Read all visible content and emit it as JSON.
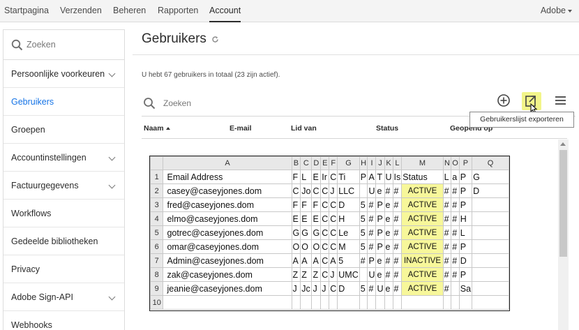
{
  "topnav": {
    "tabs": [
      {
        "label": "Startpagina",
        "active": false
      },
      {
        "label": "Verzenden",
        "active": false
      },
      {
        "label": "Beheren",
        "active": false
      },
      {
        "label": "Rapporten",
        "active": false
      },
      {
        "label": "Account",
        "active": true
      }
    ],
    "account_menu": "Adobe"
  },
  "sidebar": {
    "search_placeholder": "Zoeken",
    "items": [
      {
        "label": "Persoonlijke voorkeuren",
        "expandable": true,
        "active": false
      },
      {
        "label": "Gebruikers",
        "expandable": false,
        "active": true
      },
      {
        "label": "Groepen",
        "expandable": false,
        "active": false
      },
      {
        "label": "Accountinstellingen",
        "expandable": true,
        "active": false
      },
      {
        "label": "Factuurgegevens",
        "expandable": true,
        "active": false
      },
      {
        "label": "Workflows",
        "expandable": false,
        "active": false
      },
      {
        "label": "Gedeelde bibliotheken",
        "expandable": false,
        "active": false
      },
      {
        "label": "Privacy",
        "expandable": false,
        "active": false
      },
      {
        "label": "Adobe Sign-API",
        "expandable": true,
        "active": false
      },
      {
        "label": "Webhooks",
        "expandable": false,
        "active": false
      }
    ]
  },
  "main": {
    "title": "Gebruikers",
    "summary": "U hebt 67 gebruikers in totaal (23 zijn actief).",
    "search_placeholder": "Zoeken",
    "export_tooltip": "Gebruikerslijst exporteren",
    "columns": [
      "Naam",
      "E-mail",
      "Lid van",
      "Status",
      "Geopend op"
    ]
  },
  "colors": {
    "accent": "#1473e6",
    "status_highlight": "#f7f79a",
    "export_highlight": "#f2f58a"
  },
  "spreadsheet": {
    "column_headers": [
      "A",
      "B",
      "C",
      "D",
      "E",
      "F",
      "G",
      "H",
      "I",
      "J",
      "K",
      "L",
      "M",
      "N",
      "O",
      "P",
      "Q"
    ],
    "rows": [
      {
        "n": "1",
        "cells": [
          "Email Address",
          "F",
          "L",
          "E",
          "Ir",
          "C",
          "Ti",
          "P",
          "A",
          "T",
          "U",
          "Is",
          "Status",
          "L",
          "a",
          "P",
          "G"
        ]
      },
      {
        "n": "2",
        "cells": [
          "casey@caseyjones.dom",
          "C",
          "Jo",
          "C",
          "C",
          "J",
          "LLC",
          "",
          "U",
          "e",
          "#",
          "#",
          "ACTIVE",
          "#",
          "#",
          "P",
          "D"
        ]
      },
      {
        "n": "3",
        "cells": [
          "fred@caseyjones.dom",
          "F",
          "F",
          "F",
          "C",
          "C",
          "D",
          "5",
          "#",
          "P",
          "e",
          "#",
          "ACTIVE",
          "#",
          "#",
          "P",
          ""
        ]
      },
      {
        "n": "4",
        "cells": [
          "elmo@caseyjones.dom",
          "E",
          "E",
          "E",
          "C",
          "C",
          "H",
          "5",
          "#",
          "P",
          "e",
          "#",
          "ACTIVE",
          "#",
          "#",
          "H",
          ""
        ]
      },
      {
        "n": "5",
        "cells": [
          "gotrec@caseyjones.dom",
          "G",
          "G",
          "G",
          "C",
          "C",
          "Le",
          "5",
          "#",
          "P",
          "e",
          "#",
          "ACTIVE",
          "#",
          "#",
          "L",
          ""
        ]
      },
      {
        "n": "6",
        "cells": [
          "omar@caseyjones.dom",
          "O",
          "O",
          "O",
          "C",
          "C",
          "M",
          "5",
          "#",
          "P",
          "e",
          "#",
          "ACTIVE",
          "#",
          "#",
          "P",
          ""
        ]
      },
      {
        "n": "7",
        "cells": [
          "Admin@caseyjones.dom",
          "A",
          "A",
          "A",
          "C",
          "A",
          "5",
          "#",
          "P",
          "e",
          "#",
          "#",
          "INACTIVE",
          "#",
          "#",
          "D",
          ""
        ]
      },
      {
        "n": "8",
        "cells": [
          "zak@caseyjones.dom",
          "Z",
          "Z",
          "Z",
          "C",
          "J",
          "UMC",
          "",
          "U",
          "e",
          "#",
          "#",
          "ACTIVE",
          "#",
          "#",
          "P",
          ""
        ]
      },
      {
        "n": "9",
        "cells": [
          "jeanie@caseyjones.dom",
          "J",
          "Jc",
          "J",
          "J",
          "C",
          "D",
          "5",
          "#",
          "U",
          "e",
          "#",
          "ACTIVE",
          "#",
          "",
          "Sa",
          ""
        ]
      },
      {
        "n": "10",
        "cells": [
          "",
          "",
          "",
          "",
          "",
          "",
          "",
          "",
          "",
          "",
          "",
          "",
          "",
          "",
          "",
          "",
          ""
        ]
      }
    ]
  }
}
